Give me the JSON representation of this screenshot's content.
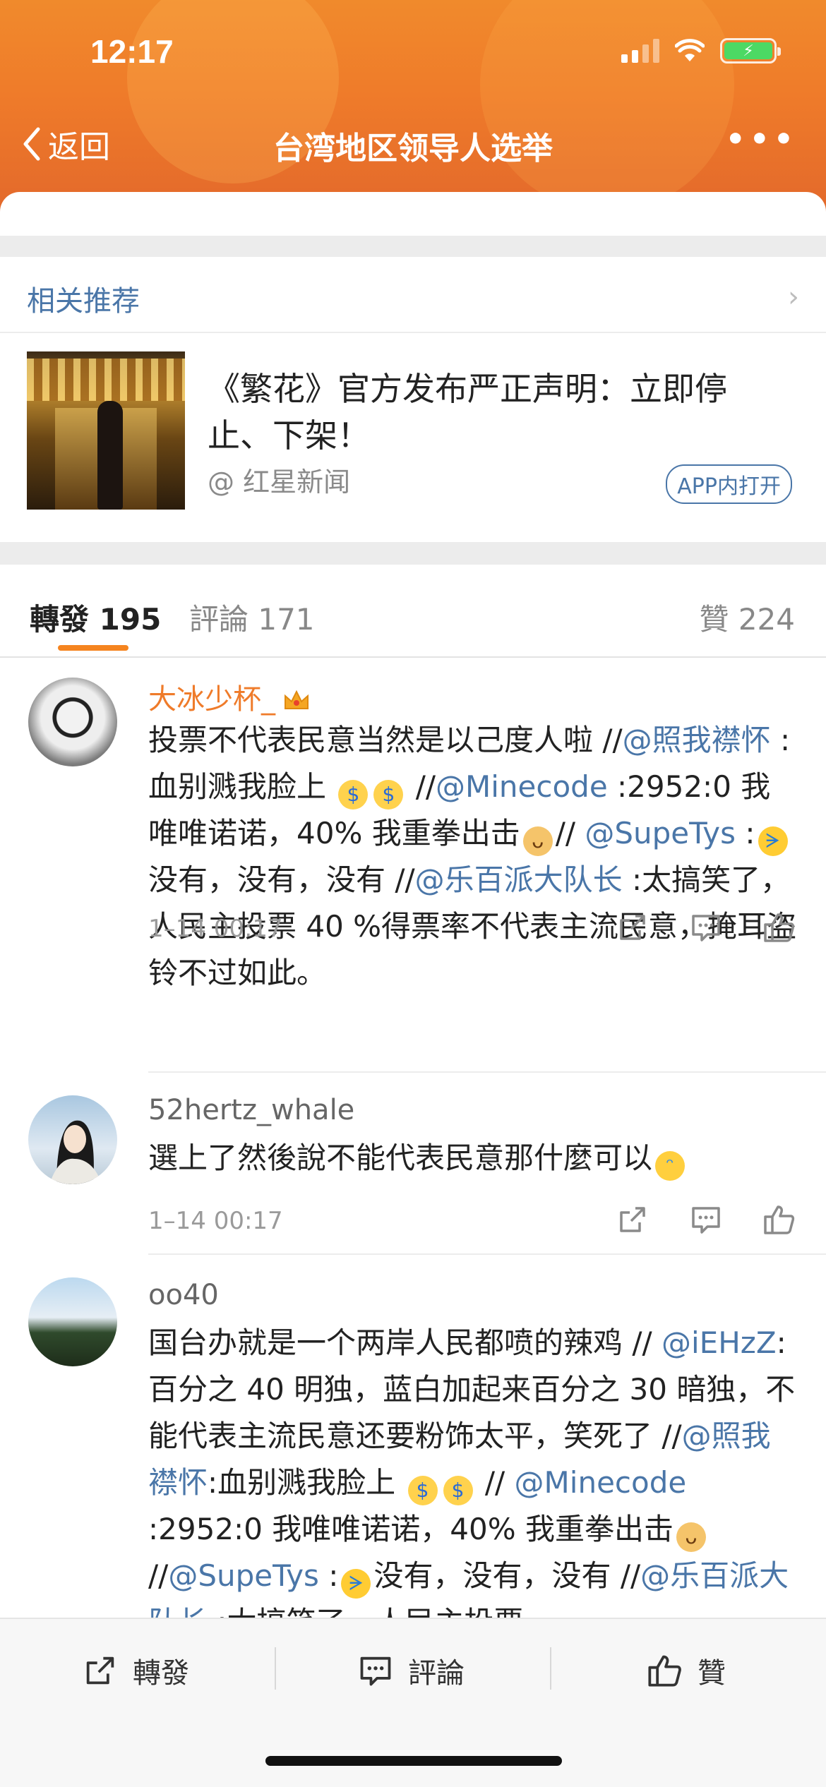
{
  "status_bar": {
    "time": "12:17",
    "battery_glyph": "⚡"
  },
  "nav": {
    "back_label": "返回",
    "title": "台湾地区领导人选举",
    "more_label": "•••"
  },
  "related": {
    "header": "相关推荐",
    "chevron": "›",
    "card": {
      "title": "《繁花》官方发布严正声明：立即停止、下架！",
      "source": "@ 红星新闻",
      "open_button": "APP内打开"
    }
  },
  "tabs": {
    "repost": "轉發 195",
    "comment": "評論 171",
    "like": "贊 224"
  },
  "posts": [
    {
      "user": "大冰少杯_",
      "time": "1–14 00:17",
      "segments": [
        {
          "t": "投票不代表民意当然是以己度人啦 //"
        },
        {
          "t": "@照我襟怀",
          "m": true
        },
        {
          "t": " :血别溅我脸上 "
        },
        {
          "e": "money",
          "g": "$"
        },
        {
          "e": "money",
          "g": "$"
        },
        {
          "t": " //"
        },
        {
          "t": "@Minecode",
          "m": true
        },
        {
          "t": " :2952:0 我唯唯诺诺，40% 我重拳出击"
        },
        {
          "e": "doge",
          "g": "ᴗ"
        },
        {
          "t": "// "
        },
        {
          "t": "@SupeTys",
          "m": true
        },
        {
          "t": " :"
        },
        {
          "e": "cry",
          "g": "ᗒ"
        },
        {
          "t": "没有，没有，没有 //"
        },
        {
          "t": "@乐百派大队长",
          "m": true
        },
        {
          "t": " :太搞笑了，人民主投票 40 %得票率不代表主流民意，掩耳盗铃不过如此。"
        }
      ]
    },
    {
      "user": "52hertz_whale",
      "time": "1–14 00:17",
      "segments": [
        {
          "t": "選上了然後說不能代表民意那什麼可以"
        },
        {
          "e": "sweat",
          "g": "ᵔ"
        }
      ]
    },
    {
      "user": "oo40",
      "segments": [
        {
          "t": "国台办就是一个两岸人民都喷的辣鸡 // "
        },
        {
          "t": "@iEHzZ",
          "m": true
        },
        {
          "t": ":百分之 40 明独，蓝白加起来百分之 30 暗独，不能代表主流民意还要粉饰太平，笑死了 //"
        },
        {
          "t": "@照我襟怀",
          "m": true
        },
        {
          "t": ":血别溅我脸上 "
        },
        {
          "e": "money",
          "g": "$"
        },
        {
          "e": "money",
          "g": "$"
        },
        {
          "t": " // "
        },
        {
          "t": "@Minecode",
          "m": true
        },
        {
          "t": " :2952:0 我唯唯诺诺，40% 我重拳出击"
        },
        {
          "e": "doge",
          "g": "ᴗ"
        },
        {
          "t": "//"
        },
        {
          "t": "@SupeTys",
          "m": true
        },
        {
          "t": " :"
        },
        {
          "e": "cry",
          "g": "ᗒ"
        },
        {
          "t": "没有，没有，没有 //"
        },
        {
          "t": "@乐百派大队长",
          "m": true
        },
        {
          "t": " :太搞笑了，人民主投票"
        }
      ]
    }
  ],
  "bottom_bar": {
    "repost": "轉發",
    "comment": "評論",
    "like": "贊"
  },
  "colors": {
    "accent": "#f5841f",
    "link": "#4a76a8",
    "username_vip": "#ef7b2a"
  }
}
